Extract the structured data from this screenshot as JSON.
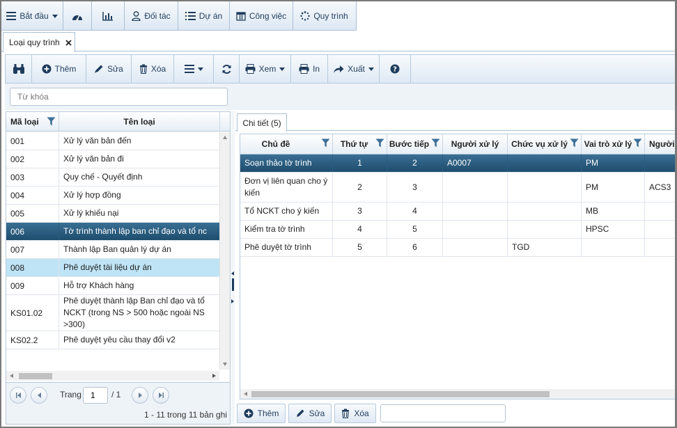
{
  "menu": {
    "start": "Bắt đầu",
    "partners": "Đối tác",
    "projects": "Dự án",
    "tasks": "Công việc",
    "workflow": "Quy trình"
  },
  "doc_tab": {
    "label": "Loại quy trình"
  },
  "toolbar": {
    "add": "Thêm",
    "edit": "Sửa",
    "delete": "Xóa",
    "view": "Xem",
    "print": "In",
    "export": "Xuất"
  },
  "search": {
    "placeholder": "Từ khóa"
  },
  "left_grid": {
    "columns": [
      "Mã loại",
      "Tên loại"
    ],
    "rows": [
      {
        "code": "001",
        "name": "Xử lý văn bản đến"
      },
      {
        "code": "002",
        "name": "Xử lý văn bản đi"
      },
      {
        "code": "003",
        "name": "Quy chế - Quyết định"
      },
      {
        "code": "004",
        "name": "Xử lý hợp đồng"
      },
      {
        "code": "005",
        "name": "Xử lý khiếu nại"
      },
      {
        "code": "006",
        "name": "Tờ trình thành lập ban chỉ đạo và tổ nc"
      },
      {
        "code": "007",
        "name": "Thành lập Ban quản lý dự án"
      },
      {
        "code": "008",
        "name": "Phê duyệt tài liệu dự án"
      },
      {
        "code": "009",
        "name": "Hỗ trợ Khách hàng"
      },
      {
        "code": "KS01.02",
        "name": "Phê duyệt thành lập Ban chỉ đạo và tổ NCKT (trong NS > 500 hoặc ngoài NS >300)"
      },
      {
        "code": "KS02.2",
        "name": "Phê duyệt yêu cầu thay đổi v2"
      }
    ]
  },
  "pager": {
    "page_label": "Trang",
    "page_value": "1",
    "page_total": "/ 1",
    "summary": "1 - 11 trong 11 bản ghi"
  },
  "detail_tab": {
    "label": "Chi tiết (5)"
  },
  "right_grid": {
    "columns": [
      "Chủ đề",
      "Thứ tự",
      "Bước tiếp",
      "Người xử lý",
      "Chức vụ xử lý",
      "Vai trò xử lý",
      "Người"
    ],
    "rows": [
      {
        "topic": "Soạn thảo tờ trình",
        "order": "1",
        "next": "2",
        "handler": "A0007",
        "position": "",
        "role": "PM",
        "other": ""
      },
      {
        "topic": "Đơn vị liên quan cho ý kiến",
        "order": "2",
        "next": "3",
        "handler": "",
        "position": "",
        "role": "PM",
        "other": "ACS3"
      },
      {
        "topic": "Tổ NCKT cho ý kiến",
        "order": "3",
        "next": "4",
        "handler": "",
        "position": "",
        "role": "MB",
        "other": ""
      },
      {
        "topic": "Kiểm tra tờ trình",
        "order": "4",
        "next": "5",
        "handler": "",
        "position": "",
        "role": "HPSC",
        "other": ""
      },
      {
        "topic": "Phê duyệt tờ trình",
        "order": "5",
        "next": "6",
        "handler": "",
        "position": "TGD",
        "role": "",
        "other": ""
      }
    ]
  },
  "bottom_buttons": {
    "add": "Thêm",
    "edit": "Sửa",
    "delete": "Xóa"
  },
  "colors": {
    "selected_row": "#1e4d6e",
    "highlight_row": "#bfe4f6",
    "accent": "#1f3c5c"
  },
  "icons": [
    "menu-icon",
    "dashboard-icon",
    "chart-icon",
    "user-icon",
    "list-icon",
    "calendar-icon",
    "spinner-icon",
    "close-icon",
    "binoculars-icon",
    "plus-circle-icon",
    "pencil-icon",
    "trash-icon",
    "refresh-icon",
    "printer-icon",
    "share-icon",
    "help-icon",
    "filter-icon"
  ]
}
